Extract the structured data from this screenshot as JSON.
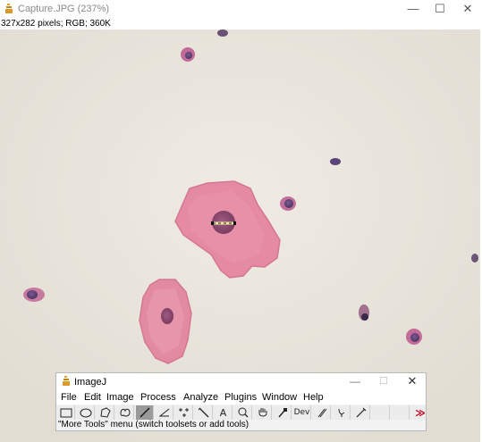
{
  "image_window": {
    "title": "Capture.JPG (237%)",
    "info": "327x282 pixels; RGB; 360K",
    "controls": {
      "minimize": "—",
      "maximize": "☐",
      "close": "✕"
    }
  },
  "imagej": {
    "title": "ImageJ",
    "controls": {
      "minimize": "—",
      "maximize": "☐",
      "close": "✕"
    },
    "menu": [
      "File",
      "Edit",
      "Image",
      "Process",
      "Analyze",
      "Plugins",
      "Window",
      "Help"
    ],
    "tools": [
      {
        "name": "rectangle-tool-icon",
        "glyph": ""
      },
      {
        "name": "oval-tool-icon",
        "glyph": ""
      },
      {
        "name": "polygon-tool-icon",
        "glyph": ""
      },
      {
        "name": "freehand-tool-icon",
        "glyph": ""
      },
      {
        "name": "straight-line-tool-icon",
        "glyph": "",
        "active": true
      },
      {
        "name": "angle-tool-icon",
        "glyph": ""
      },
      {
        "name": "multipoint-tool-icon",
        "glyph": ""
      },
      {
        "name": "wand-tool-icon",
        "glyph": ""
      },
      {
        "name": "text-tool-icon",
        "glyph": "A"
      },
      {
        "name": "magnifier-tool-icon",
        "glyph": ""
      },
      {
        "name": "hand-tool-icon",
        "glyph": ""
      },
      {
        "name": "color-picker-tool-icon",
        "glyph": ""
      },
      {
        "name": "developer-menu-icon",
        "glyph": "Dev"
      },
      {
        "name": "stacks-menu-icon",
        "glyph": ""
      },
      {
        "name": "brush-tool-icon",
        "glyph": ""
      },
      {
        "name": "pencil-tool-icon",
        "glyph": ""
      },
      {
        "name": "more-tools-icon",
        "glyph": "≫"
      }
    ],
    "status": "\"More Tools\" menu (switch toolsets or add tools)"
  },
  "colors": {
    "background": "#e9e5dd",
    "cell_pink": "#e48aa2",
    "nucleus": "#8b4a6d",
    "accent_red": "#c8001e"
  }
}
